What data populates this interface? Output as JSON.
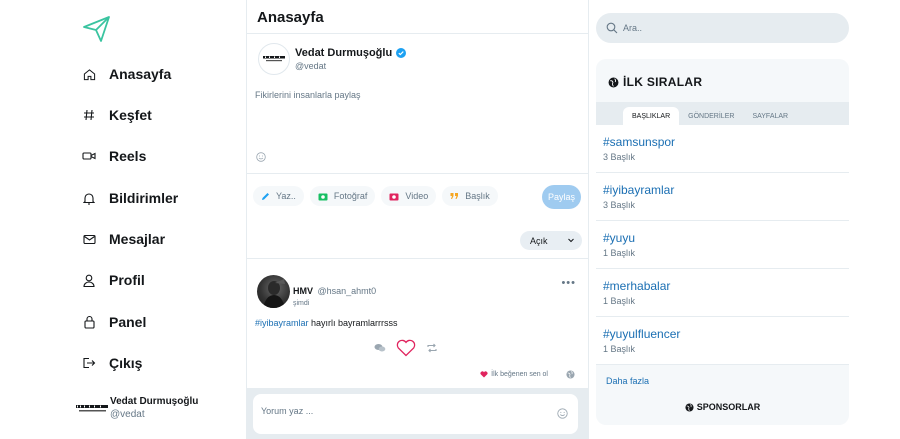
{
  "nav": {
    "items": [
      {
        "label": "Anasayfa",
        "icon": "home-icon"
      },
      {
        "label": "Keşfet",
        "icon": "hashtag-icon"
      },
      {
        "label": "Reels",
        "icon": "video-camera-icon"
      },
      {
        "label": "Bildirimler",
        "icon": "bell-icon"
      },
      {
        "label": "Mesajlar",
        "icon": "mail-icon"
      },
      {
        "label": "Profil",
        "icon": "user-icon"
      },
      {
        "label": "Panel",
        "icon": "lock-icon"
      },
      {
        "label": "Çıkış",
        "icon": "logout-icon"
      }
    ],
    "me": {
      "name": "Vedat Durmuşoğlu",
      "handle": "@vedat"
    }
  },
  "center": {
    "title": "Anasayfa",
    "compose": {
      "name": "Vedat Durmuşoğlu",
      "handle": "@vedat",
      "placeholder": "Fikirlerini insanlarla paylaş",
      "chips": [
        "Yaz..",
        "Fotoğraf",
        "Video",
        "Başlık"
      ],
      "share": "Paylaş",
      "visibility": "Açık"
    },
    "post": {
      "name": "HMV",
      "handle": "@hsan_ahmt0",
      "time": "şimdi",
      "hashtag": "#iyibayramlar",
      "text": " hayırlı bayramlarrrsss",
      "likes_text": "İlk beğenen sen ol"
    },
    "comment_placeholder": "Yorum yaz ..."
  },
  "right": {
    "search_placeholder": "Ara..",
    "trends_title": "İLK SIRALAR",
    "tabs": [
      "BAŞLIKLAR",
      "GÖNDERİLER",
      "SAYFALAR"
    ],
    "trends": [
      {
        "tag": "#samsunspor",
        "count": "3 Başlık"
      },
      {
        "tag": "#iyibayramlar",
        "count": "3 Başlık"
      },
      {
        "tag": "#yuyu",
        "count": "1 Başlık"
      },
      {
        "tag": "#merhabalar",
        "count": "1 Başlık"
      },
      {
        "tag": "#yuyulfluencer",
        "count": "1 Başlık"
      }
    ],
    "more": "Daha fazla",
    "sponsors": "SPONSORLAR"
  },
  "colors": {
    "accent": "#1b6fb3",
    "logo": "#3ac4a0",
    "share_button": "#9fcbf0",
    "like_heart": "#e0245e"
  }
}
